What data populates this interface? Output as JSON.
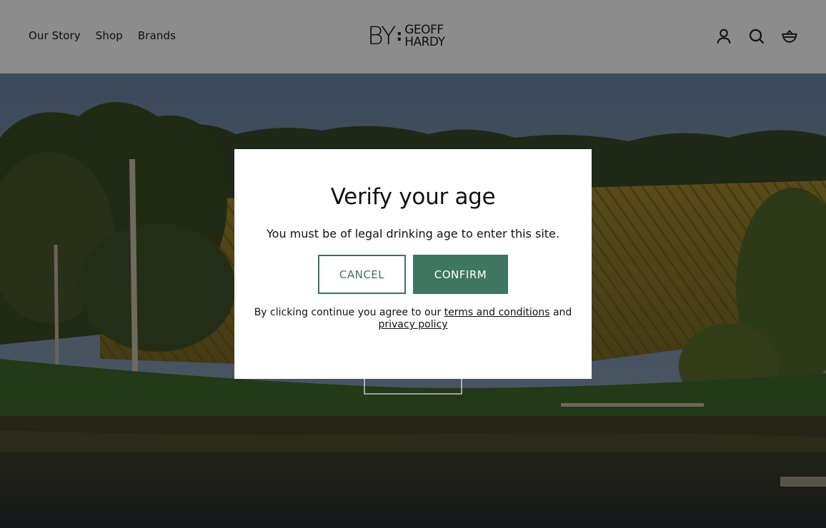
{
  "nav": {
    "items": [
      "Our Story",
      "Shop",
      "Brands"
    ]
  },
  "logo": {
    "prefix": "BY",
    "separator": ":",
    "line1": "GEOFF",
    "line2": "HARDY"
  },
  "header_icons": [
    "account-icon",
    "search-icon",
    "cart-icon"
  ],
  "modal": {
    "title": "Verify your age",
    "subtitle": "You must be of legal drinking age to enter this site.",
    "cancel_label": "CANCEL",
    "confirm_label": "CONFIRM",
    "legal_prefix": "By clicking continue you agree to our",
    "terms_link": "terms and conditions",
    "legal_and": "and",
    "privacy_link": "privacy policy"
  },
  "colors": {
    "accent": "#3f7661",
    "overlay": "rgba(0,0,0,0.45)"
  }
}
